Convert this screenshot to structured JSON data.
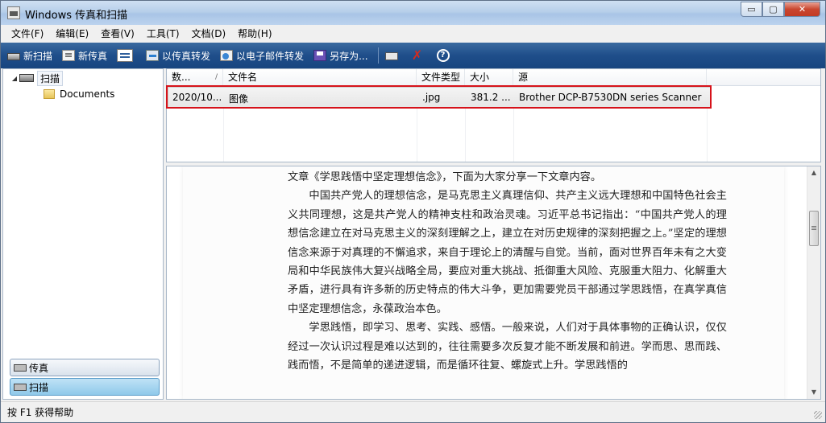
{
  "window": {
    "title": "Windows 传真和扫描",
    "caption_buttons": {
      "minimize": "▭",
      "maximize": "▢",
      "close": "✕"
    }
  },
  "menu": [
    "文件(F)",
    "编辑(E)",
    "查看(V)",
    "工具(T)",
    "文档(D)",
    "帮助(H)"
  ],
  "toolbar": {
    "new_scan": "新扫描",
    "new_fax": "新传真",
    "forward_as_fax": "以传真转发",
    "forward_as_email": "以电子邮件转发",
    "save_as": "另存为...",
    "help_glyph": "?",
    "delete_glyph": "✗"
  },
  "tree": {
    "root": "扫描",
    "child": "Documents"
  },
  "nav": {
    "fax": "传真",
    "scan": "扫描"
  },
  "list": {
    "headers": [
      "数...",
      "文件名",
      "文件类型",
      "大小",
      "源"
    ],
    "sort_indicator": "/",
    "rows": [
      {
        "date": "2020/10...",
        "name": "图像",
        "type": ".jpg",
        "size": "381.2 ...",
        "source": "Brother DCP-B7530DN series Scanner"
      }
    ]
  },
  "preview": {
    "paragraphs": [
      {
        "indent": false,
        "text": "文章《学思践悟中坚定理想信念》，下面为大家分享一下文章内容。"
      },
      {
        "indent": true,
        "text": "中国共产党人的理想信念，是马克思主义真理信仰、共产主义远大理想和中国特色社会主义共同理想，这是共产党人的精神支柱和政治灵魂。习近平总书记指出：“中国共产党人的理想信念建立在对马克思主义的深刻理解之上，建立在对历史规律的深刻把握之上。”坚定的理想信念来源于对真理的不懈追求，来自于理论上的清醒与自觉。当前，面对世界百年未有之大变局和中华民族伟大复兴战略全局，要应对重大挑战、抵御重大风险、克服重大阻力、化解重大矛盾，进行具有许多新的历史特点的伟大斗争，更加需要党员干部通过学思践悟，在真学真信中坚定理想信念，永葆政治本色。"
      },
      {
        "indent": true,
        "text": "学思践悟，即学习、思考、实践、感悟。一般来说，人们对于具体事物的正确认识，仅仅经过一次认识过程是难以达到的，往往需要多次反复才能不断发展和前进。学而思、思而践、践而悟，不是简单的递进逻辑，而是循环往复、螺旋式上升。学思践悟的"
      }
    ]
  },
  "status": "按 F1 获得帮助",
  "colors": {
    "toolbar": "#1f4e8a",
    "highlight": "#d6121a",
    "nav_active": "#8fc9ea"
  }
}
